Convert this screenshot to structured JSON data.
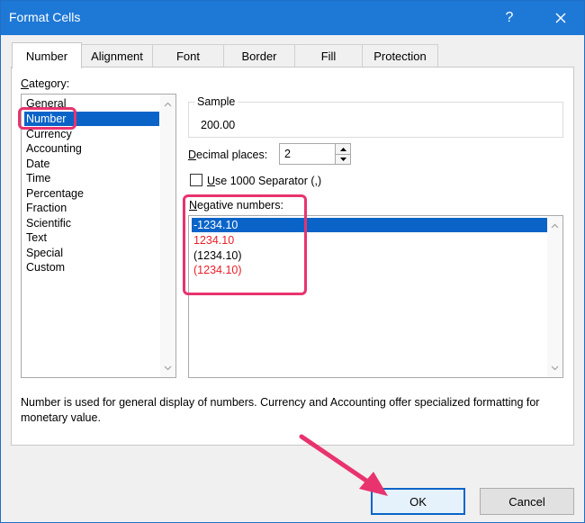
{
  "window": {
    "title": "Format Cells",
    "help_label": "?"
  },
  "tabs": [
    {
      "label": "Number",
      "active": true
    },
    {
      "label": "Alignment",
      "active": false
    },
    {
      "label": "Font",
      "active": false
    },
    {
      "label": "Border",
      "active": false
    },
    {
      "label": "Fill",
      "active": false
    },
    {
      "label": "Protection",
      "active": false
    }
  ],
  "category": {
    "label_underlined": "C",
    "label_rest": "ategory:",
    "items": [
      "General",
      "Number",
      "Currency",
      "Accounting",
      "Date",
      "Time",
      "Percentage",
      "Fraction",
      "Scientific",
      "Text",
      "Special",
      "Custom"
    ],
    "selected": "Number"
  },
  "sample": {
    "label": "Sample",
    "value": "200.00"
  },
  "decimal_places": {
    "label_underlined": "D",
    "label_rest": "ecimal places:",
    "value": "2"
  },
  "separator": {
    "label_underlined": "U",
    "label_rest": "se 1000 Separator (,)",
    "checked": false
  },
  "negative_numbers": {
    "label_underlined": "N",
    "label_rest": "egative numbers:",
    "items": [
      {
        "text": "-1234.10",
        "color": "#000000",
        "selected": true
      },
      {
        "text": "1234.10",
        "color": "#e8202a",
        "selected": false
      },
      {
        "text": "(1234.10)",
        "color": "#000000",
        "selected": false
      },
      {
        "text": "(1234.10)",
        "color": "#e8202a",
        "selected": false
      }
    ]
  },
  "description": "Number is used for general display of numbers.  Currency and Accounting offer specialized formatting for monetary value.",
  "buttons": {
    "ok": "OK",
    "cancel": "Cancel"
  },
  "colors": {
    "accent": "#1e78d6",
    "selection": "#0a64c8",
    "annotation": "#e8336e",
    "negative_red": "#e8202a"
  }
}
